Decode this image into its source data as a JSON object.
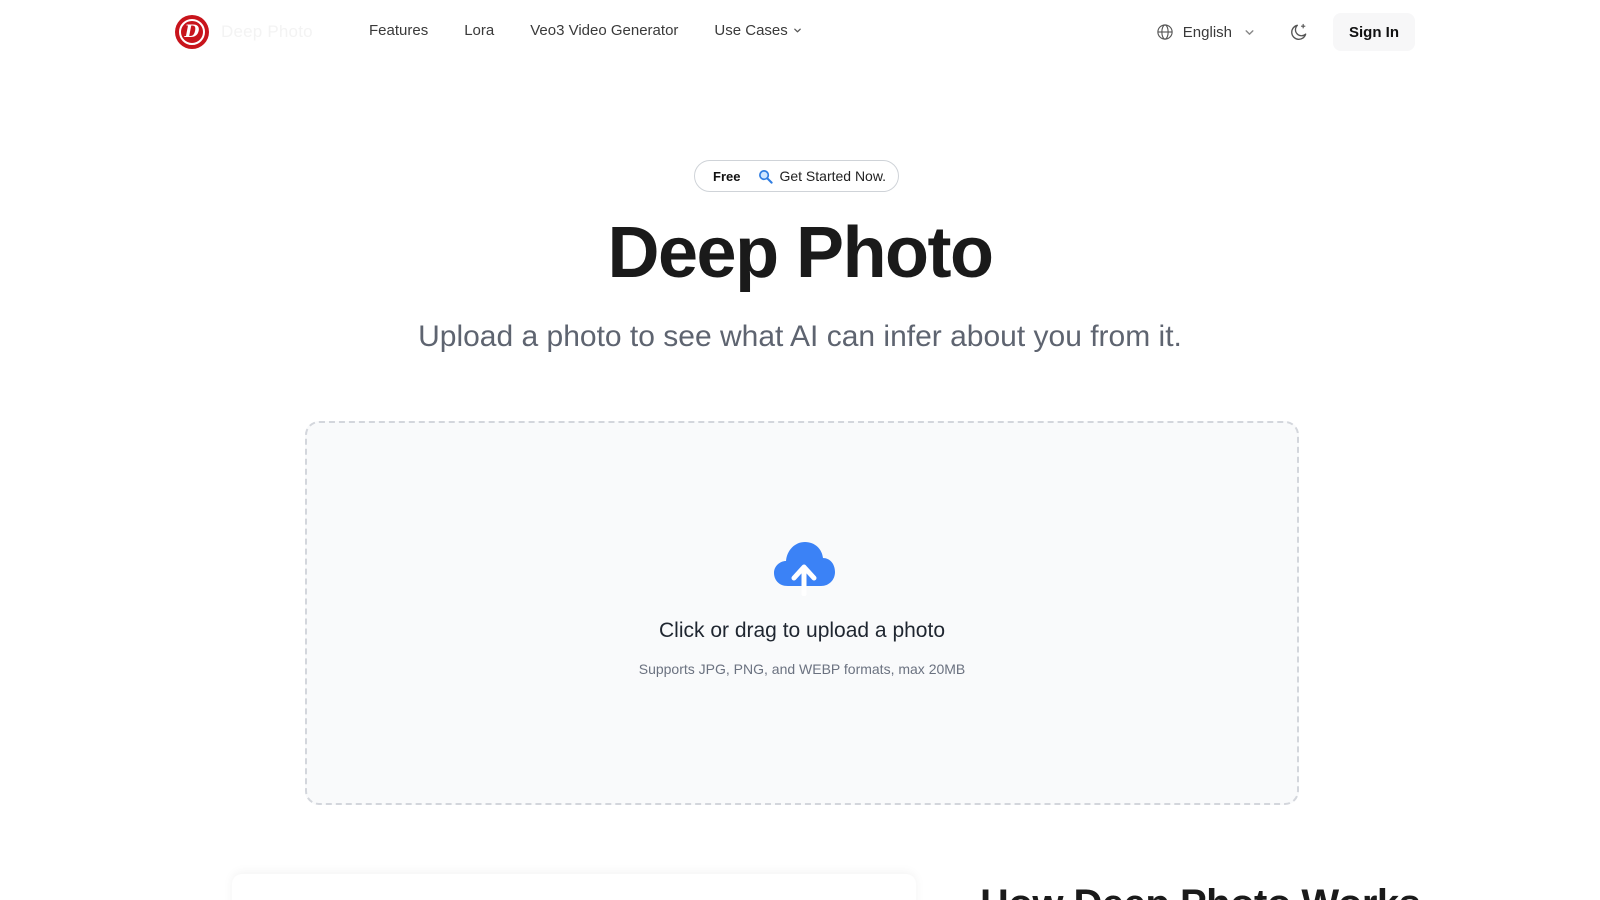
{
  "nav": {
    "logo_text": "Deep Photo",
    "links": [
      "Features",
      "Lora",
      "Veo3 Video Generator",
      "Use Cases"
    ],
    "language": "English",
    "signin_label": "Sign In"
  },
  "hero": {
    "badge_free": "Free",
    "badge_cta": "Get Started Now.",
    "title": "Deep Photo",
    "subtitle": "Upload a photo to see what AI can infer about you from it."
  },
  "upload": {
    "title": "Click or drag to upload a photo",
    "hint": "Supports JPG, PNG, and WEBP formats, max 20MB"
  },
  "section": {
    "how_title": "How Deep Photo Works"
  },
  "colors": {
    "brand": "#c8141c",
    "upload_icon": "#3b82f6"
  },
  "icons": [
    "logo-mark",
    "chevron-down-icon",
    "globe-icon",
    "moon-icon",
    "search-icon",
    "cloud-upload-icon"
  ]
}
